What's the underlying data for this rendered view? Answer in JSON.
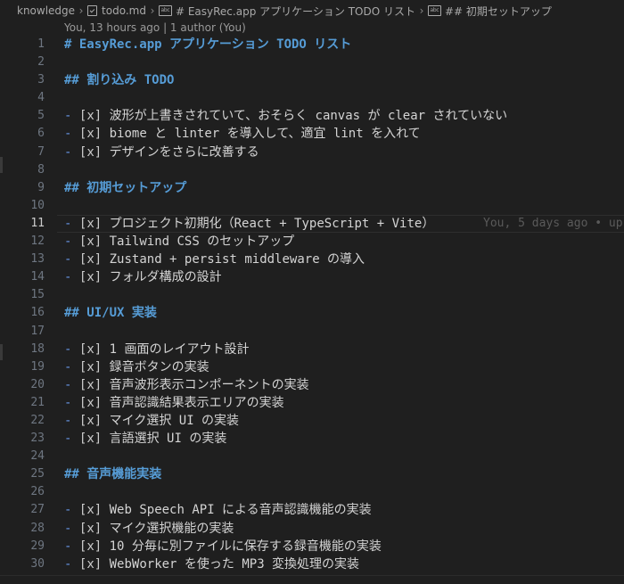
{
  "breadcrumb": {
    "folder": "knowledge",
    "file": "todo.md",
    "symbol1": "# EasyRec.app アプリケーション TODO リスト",
    "symbol2": "## 初期セットアップ",
    "symbol_icon": "abc"
  },
  "codelens": "You, 13 hours ago | 1 author (You)",
  "blame_inline": "You, 5 days ago • up",
  "lines": [
    {
      "n": "1",
      "kind": "h1",
      "text": "# EasyRec.app アプリケーション TODO リスト"
    },
    {
      "n": "2",
      "kind": "blank"
    },
    {
      "n": "3",
      "kind": "h2",
      "text": "## 割り込み TODO"
    },
    {
      "n": "4",
      "kind": "blank"
    },
    {
      "n": "5",
      "kind": "task",
      "text": "波形が上書きされていて、おそらく canvas が clear されていない"
    },
    {
      "n": "6",
      "kind": "task",
      "text": "biome と linter を導入して、適宜 lint を入れて"
    },
    {
      "n": "7",
      "kind": "task",
      "text": "デザインをさらに改善する"
    },
    {
      "n": "8",
      "kind": "blank"
    },
    {
      "n": "9",
      "kind": "h2",
      "text": "## 初期セットアップ"
    },
    {
      "n": "10",
      "kind": "blank"
    },
    {
      "n": "11",
      "kind": "task",
      "text": "プロジェクト初期化（React + TypeScript + Vite）",
      "current": true
    },
    {
      "n": "12",
      "kind": "task",
      "text": "Tailwind CSS のセットアップ"
    },
    {
      "n": "13",
      "kind": "task",
      "text": "Zustand + persist middleware の導入"
    },
    {
      "n": "14",
      "kind": "task",
      "text": "フォルダ構成の設計"
    },
    {
      "n": "15",
      "kind": "blank"
    },
    {
      "n": "16",
      "kind": "h2",
      "text": "## UI/UX 実装"
    },
    {
      "n": "17",
      "kind": "blank"
    },
    {
      "n": "18",
      "kind": "task",
      "text": "1 画面のレイアウト設計"
    },
    {
      "n": "19",
      "kind": "task",
      "text": "録音ボタンの実装"
    },
    {
      "n": "20",
      "kind": "task",
      "text": "音声波形表示コンポーネントの実装"
    },
    {
      "n": "21",
      "kind": "task",
      "text": "音声認識結果表示エリアの実装"
    },
    {
      "n": "22",
      "kind": "task",
      "text": "マイク選択 UI の実装"
    },
    {
      "n": "23",
      "kind": "task",
      "text": "言語選択 UI の実装"
    },
    {
      "n": "24",
      "kind": "blank"
    },
    {
      "n": "25",
      "kind": "h2",
      "text": "## 音声機能実装"
    },
    {
      "n": "26",
      "kind": "blank"
    },
    {
      "n": "27",
      "kind": "task",
      "text": "Web Speech API による音声認識機能の実装"
    },
    {
      "n": "28",
      "kind": "task",
      "text": "マイク選択機能の実装"
    },
    {
      "n": "29",
      "kind": "task",
      "text": "10 分毎に別ファイルに保存する録音機能の実装"
    },
    {
      "n": "30",
      "kind": "task",
      "text": "WebWorker を使った MP3 変換処理の実装"
    }
  ],
  "task_prefix": {
    "dash": "-",
    "open": "[",
    "mark": "x",
    "close": "]"
  },
  "colors": {
    "background": "#1f1f1f",
    "heading": "#569cd6",
    "list_dash": "#6796e6",
    "line_number": "#6e7681"
  }
}
